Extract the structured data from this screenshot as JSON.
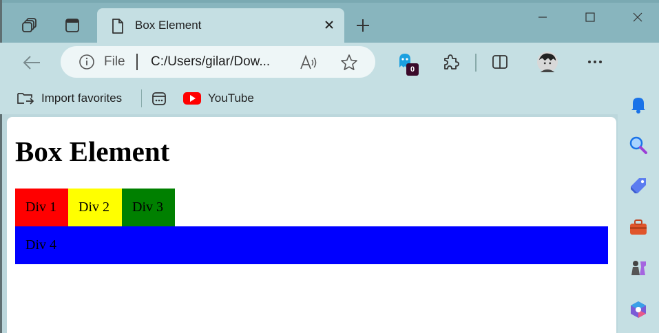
{
  "tabs": {
    "active_title": "Box Element",
    "new_tab_symbol": "+",
    "close_symbol": "×"
  },
  "window_controls": {
    "minimize": "—",
    "maximize": "☐",
    "close": "✕"
  },
  "address_bar": {
    "scheme_label": "File",
    "url": "C:/Users/gilar/Dow..."
  },
  "toolbar": {
    "extension_badge": "0",
    "more_label": "···"
  },
  "favorites": {
    "items": [
      {
        "label": "Import favorites",
        "icon": "import-favorites-icon"
      },
      {
        "label": "",
        "icon": "collections-icon"
      },
      {
        "label": "YouTube",
        "icon": "youtube-icon"
      }
    ]
  },
  "page": {
    "heading": "Box Element",
    "boxes": [
      {
        "label": "Div 1",
        "color": "#ff0000"
      },
      {
        "label": "Div 2",
        "color": "#ffff00"
      },
      {
        "label": "Div 3",
        "color": "#008000"
      },
      {
        "label": "Div 4",
        "color": "#0000ff"
      }
    ]
  },
  "sidebar": {
    "icons": [
      "bell-icon",
      "search-icon",
      "shopping-tag-icon",
      "tools-icon",
      "games-icon",
      "office-icon"
    ]
  },
  "colors": {
    "tabstrip": "#88b5be",
    "toolbar": "#c5dfe3",
    "accent_blue": "#1a73e8"
  }
}
